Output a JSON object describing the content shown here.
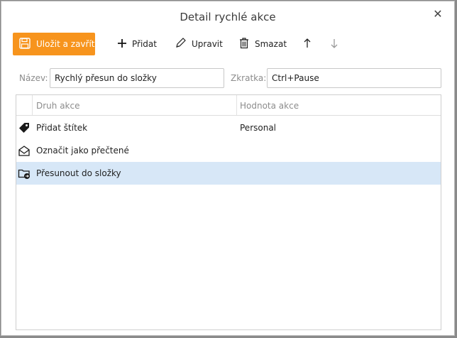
{
  "dialog": {
    "title": "Detail rychlé akce",
    "close_glyph": "✕"
  },
  "toolbar": {
    "save_label": "Uložit a zavřít",
    "add_label": "Přidat",
    "edit_label": "Upravit",
    "delete_label": "Smazat",
    "accent": "#f7941d"
  },
  "form": {
    "name_label": "Název:",
    "name_value": "Rychlý přesun do složky",
    "shortcut_label": "Zkratka:",
    "shortcut_value": "Ctrl+Pause"
  },
  "table": {
    "columns": [
      "Druh akce",
      "Hodnota akce"
    ],
    "rows": [
      {
        "icon": "tag-icon",
        "action": "Přidat štítek",
        "value": "Personal",
        "selected": false
      },
      {
        "icon": "envelope-open-icon",
        "action": "Označit jako přečtené",
        "value": "",
        "selected": false
      },
      {
        "icon": "folder-move-icon",
        "action": "Přesunout do složky",
        "value": "",
        "selected": true
      }
    ],
    "selected_color": "#d7e7f7"
  }
}
